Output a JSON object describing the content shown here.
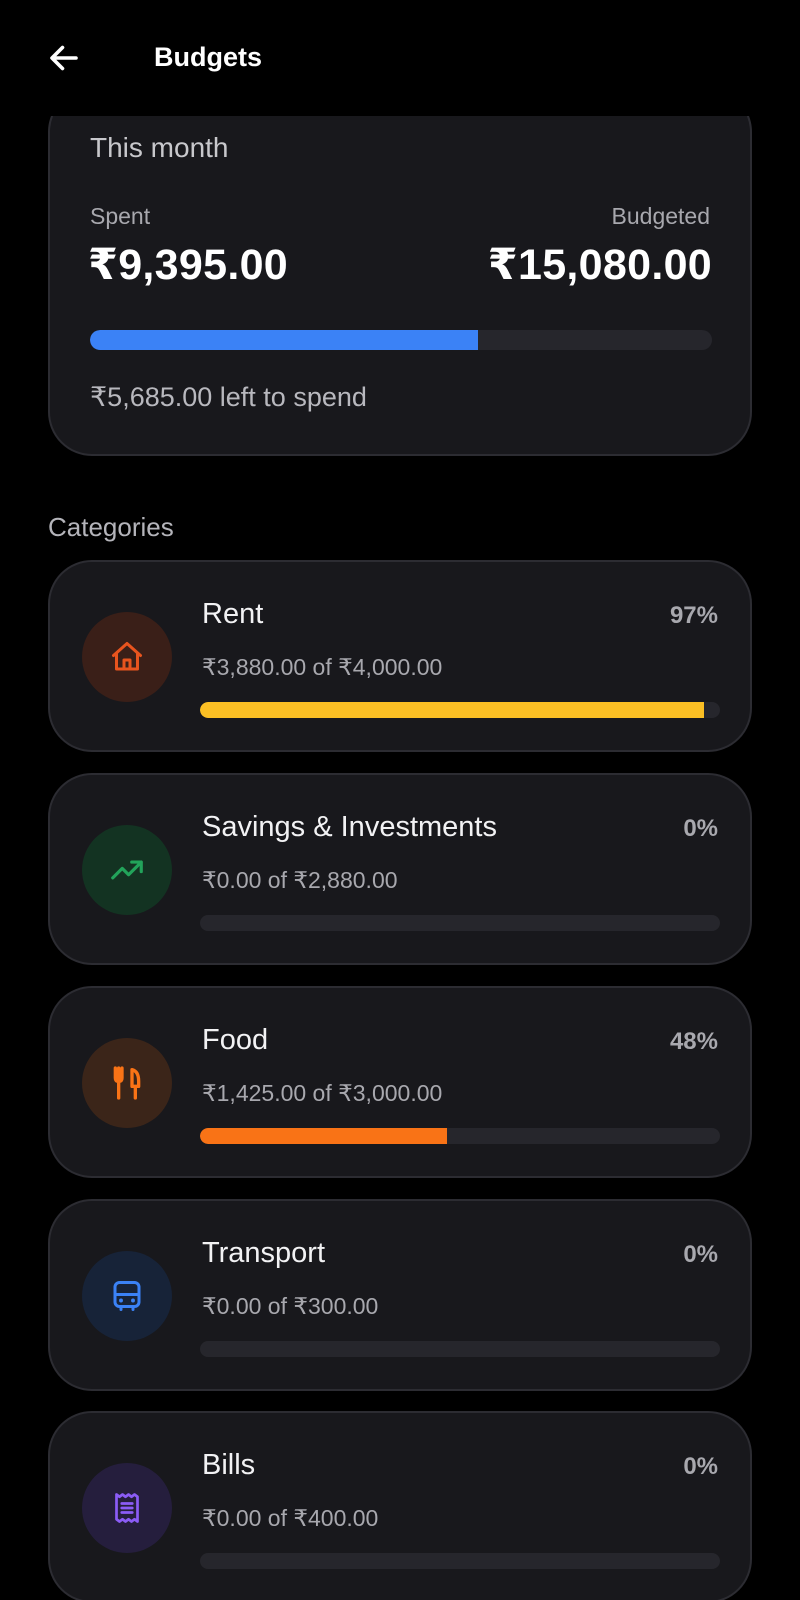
{
  "appbar": {
    "title": "Budgets",
    "back_icon": "arrow-left-icon"
  },
  "summary": {
    "title": "This month",
    "spent_label": "Spent",
    "budgeted_label": "Budgeted",
    "spent_value": "₹9,395.00",
    "budgeted_value": "₹15,080.00",
    "progress_fraction": 0.623,
    "progress_color": "#3b82f6",
    "left_text": "₹5,685.00 left to spend"
  },
  "categories_title": "Categories",
  "categories": [
    {
      "name": "Rent",
      "percent": "97%",
      "amount": "₹3,880.00 of ₹4,000.00",
      "progress_fraction": 0.97,
      "bar_color": "#fbbf24",
      "icon": "home-icon",
      "icon_color": "#e8541e",
      "icon_bg": "#3a1f18"
    },
    {
      "name": "Savings & Investments",
      "percent": "0%",
      "amount": "₹0.00 of ₹2,880.00",
      "progress_fraction": 0,
      "bar_color": "#22c55e",
      "icon": "trending-up-icon",
      "icon_color": "#22a35a",
      "icon_bg": "#133322"
    },
    {
      "name": "Food",
      "percent": "48%",
      "amount": "₹1,425.00 of ₹3,000.00",
      "progress_fraction": 0.475,
      "bar_color": "#f97316",
      "icon": "restaurant-icon",
      "icon_color": "#f97316",
      "icon_bg": "#3b2519"
    },
    {
      "name": "Transport",
      "percent": "0%",
      "amount": "₹0.00 of ₹300.00",
      "progress_fraction": 0,
      "bar_color": "#3b82f6",
      "icon": "bus-icon",
      "icon_color": "#3b82f6",
      "icon_bg": "#172338"
    },
    {
      "name": "Bills",
      "percent": "0%",
      "amount": "₹0.00 of ₹400.00",
      "progress_fraction": 0,
      "bar_color": "#8b5cf6",
      "icon": "receipt-icon",
      "icon_color": "#8b5cf6",
      "icon_bg": "#251e3d"
    }
  ]
}
